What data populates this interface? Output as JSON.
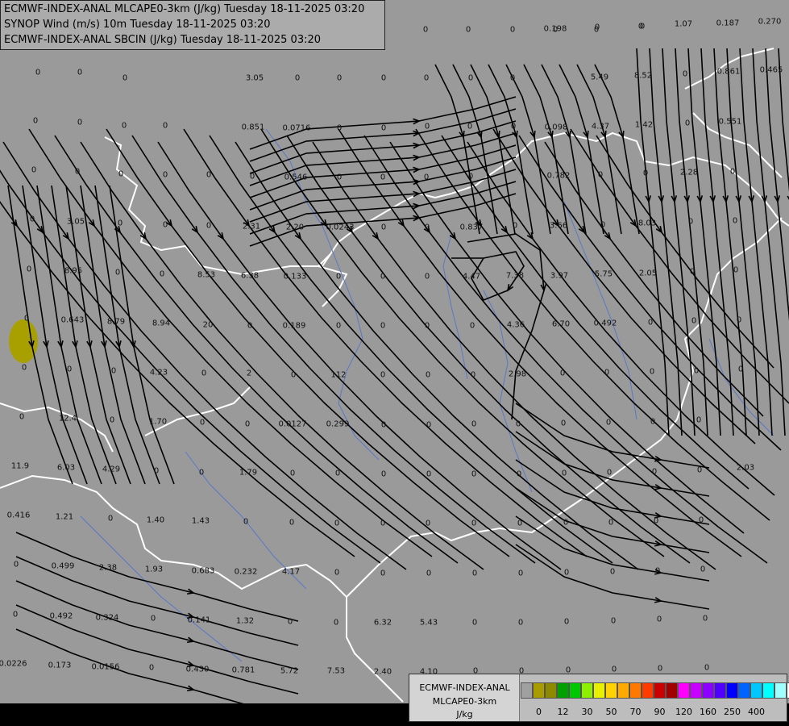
{
  "header": {
    "line1": "ECMWF-INDEX-ANAL MLCAPE0-3km (J/kg) Tuesday 18-11-2025 03:20",
    "line2": "SYNOP Wind (m/s) 10m Tuesday 18-11-2025 03:20",
    "line3": "ECMWF-INDEX-ANAL SBCIN (J/kg) Tuesday 18-11-2025 03:20"
  },
  "legend": {
    "title1": "ECMWF-INDEX-ANAL",
    "title2": "MLCAPE0-3km",
    "unit": "J/kg",
    "colors": [
      "#a0a0a0",
      "#a89c00",
      "#8e8a00",
      "#00a000",
      "#00c800",
      "#8cf000",
      "#e6f000",
      "#ffd200",
      "#ffaa00",
      "#ff7800",
      "#ff3c00",
      "#c80000",
      "#a00000",
      "#ff00ff",
      "#c800ff",
      "#8c00ff",
      "#5000ff",
      "#0000ff",
      "#0064ff",
      "#00c8ff",
      "#00ffff",
      "#a0ffff",
      "#ffffff"
    ],
    "tick_labels": [
      "0",
      "12",
      "30",
      "50",
      "70",
      "90",
      "120",
      "160",
      "250",
      "400"
    ]
  },
  "cape_values": [
    {
      "t": "0"
    },
    {
      "t": "0"
    },
    {
      "t": "0"
    },
    {
      "t": "0"
    },
    {
      "t": "0"
    },
    {
      "t": "0"
    },
    {
      "t": "1.07"
    },
    {
      "t": "0.198"
    },
    {
      "t": "0"
    },
    {
      "t": "0"
    },
    {
      "t": "0.187"
    },
    {
      "t": "0.270"
    },
    {
      "t": "0"
    },
    {
      "t": "0"
    },
    {
      "t": "0"
    },
    {
      "t": "3.05"
    },
    {
      "t": "0"
    },
    {
      "t": "0"
    },
    {
      "t": "0"
    },
    {
      "t": "0"
    },
    {
      "t": "0"
    },
    {
      "t": "0"
    },
    {
      "t": "5.49"
    },
    {
      "t": "8.52"
    },
    {
      "t": "0"
    },
    {
      "t": "0.861"
    },
    {
      "t": "0.465"
    },
    {
      "t": "0"
    },
    {
      "t": "0"
    },
    {
      "t": "0"
    },
    {
      "t": "0"
    },
    {
      "t": "0.851"
    },
    {
      "t": "0.0716"
    },
    {
      "t": "0"
    },
    {
      "t": "0"
    },
    {
      "t": "0"
    },
    {
      "t": "0"
    },
    {
      "t": "0"
    },
    {
      "t": "0.098"
    },
    {
      "t": "4.37"
    },
    {
      "t": "1.42"
    },
    {
      "t": "0"
    },
    {
      "t": "0.551"
    },
    {
      "t": "0"
    },
    {
      "t": "0"
    },
    {
      "t": "0"
    },
    {
      "t": "0"
    },
    {
      "t": "0"
    },
    {
      "t": "0"
    },
    {
      "t": "0.546"
    },
    {
      "t": "0"
    },
    {
      "t": "0"
    },
    {
      "t": "0"
    },
    {
      "t": "0"
    },
    {
      "t": "0.782"
    },
    {
      "t": "0"
    },
    {
      "t": "0"
    },
    {
      "t": "2.28"
    },
    {
      "t": "0"
    },
    {
      "t": "0"
    },
    {
      "t": "3.05"
    },
    {
      "t": "0"
    },
    {
      "t": "0"
    },
    {
      "t": "0"
    },
    {
      "t": "2.31"
    },
    {
      "t": "2.20"
    },
    {
      "t": "0.0243"
    },
    {
      "t": "0"
    },
    {
      "t": "0"
    },
    {
      "t": "0.837"
    },
    {
      "t": "0"
    },
    {
      "t": "3.66"
    },
    {
      "t": "0"
    },
    {
      "t": "8.03"
    },
    {
      "t": "0"
    },
    {
      "t": "0"
    },
    {
      "t": "0"
    },
    {
      "t": "8.95"
    },
    {
      "t": "0"
    },
    {
      "t": "0"
    },
    {
      "t": "8.53"
    },
    {
      "t": "6.38"
    },
    {
      "t": "0.133"
    },
    {
      "t": "0"
    },
    {
      "t": "0"
    },
    {
      "t": "0"
    },
    {
      "t": "4.47"
    },
    {
      "t": "7.38"
    },
    {
      "t": "3.97"
    },
    {
      "t": "5.75"
    },
    {
      "t": "2.05"
    },
    {
      "t": "0"
    },
    {
      "t": "0"
    },
    {
      "t": "0"
    },
    {
      "t": "0.643"
    },
    {
      "t": "8.79"
    },
    {
      "t": "8.94"
    },
    {
      "t": "20"
    },
    {
      "t": "0"
    },
    {
      "t": "0.189"
    },
    {
      "t": "0"
    },
    {
      "t": "0"
    },
    {
      "t": "0"
    },
    {
      "t": "0"
    },
    {
      "t": "4.36"
    },
    {
      "t": "6.70"
    },
    {
      "t": "0.492"
    },
    {
      "t": "0"
    },
    {
      "t": "0"
    },
    {
      "t": "0"
    },
    {
      "t": "0"
    },
    {
      "t": "0"
    },
    {
      "t": "0"
    },
    {
      "t": "4.23"
    },
    {
      "t": "0"
    },
    {
      "t": "2"
    },
    {
      "t": "0"
    },
    {
      "t": "112"
    },
    {
      "t": "0"
    },
    {
      "t": "0"
    },
    {
      "t": "0"
    },
    {
      "t": "2.98"
    },
    {
      "t": "0"
    },
    {
      "t": "0"
    },
    {
      "t": "0"
    },
    {
      "t": "0"
    },
    {
      "t": "0"
    },
    {
      "t": "0"
    },
    {
      "t": "12.4"
    },
    {
      "t": "0"
    },
    {
      "t": "1.70"
    },
    {
      "t": "0"
    },
    {
      "t": "0"
    },
    {
      "t": "0.0127"
    },
    {
      "t": "0.299"
    },
    {
      "t": "0"
    },
    {
      "t": "0"
    },
    {
      "t": "0"
    },
    {
      "t": "0"
    },
    {
      "t": "0"
    },
    {
      "t": "0"
    },
    {
      "t": "0"
    },
    {
      "t": "0"
    },
    {
      "t": "11.9"
    },
    {
      "t": "6.03"
    },
    {
      "t": "4.29"
    },
    {
      "t": "0"
    },
    {
      "t": "0"
    },
    {
      "t": "1.79"
    },
    {
      "t": "0"
    },
    {
      "t": "0"
    },
    {
      "t": "0"
    },
    {
      "t": "0"
    },
    {
      "t": "0"
    },
    {
      "t": "0"
    },
    {
      "t": "0"
    },
    {
      "t": "0"
    },
    {
      "t": "0"
    },
    {
      "t": "0"
    },
    {
      "t": "2.03"
    },
    {
      "t": "0.416"
    },
    {
      "t": "1.21"
    },
    {
      "t": "0"
    },
    {
      "t": "1.40"
    },
    {
      "t": "1.43"
    },
    {
      "t": "0"
    },
    {
      "t": "0"
    },
    {
      "t": "0"
    },
    {
      "t": "0"
    },
    {
      "t": "0"
    },
    {
      "t": "0"
    },
    {
      "t": "0"
    },
    {
      "t": "0"
    },
    {
      "t": "0"
    },
    {
      "t": "0"
    },
    {
      "t": "0"
    },
    {
      "t": "0"
    },
    {
      "t": "0.499"
    },
    {
      "t": "2.38"
    },
    {
      "t": "1.93"
    },
    {
      "t": "0.683"
    },
    {
      "t": "0.232"
    },
    {
      "t": "4.17"
    },
    {
      "t": "0"
    },
    {
      "t": "0"
    },
    {
      "t": "0"
    },
    {
      "t": "0"
    },
    {
      "t": "0"
    },
    {
      "t": "0"
    },
    {
      "t": "0"
    },
    {
      "t": "0"
    },
    {
      "t": "0"
    },
    {
      "t": "0"
    },
    {
      "t": "0.492"
    },
    {
      "t": "0.324"
    },
    {
      "t": "0"
    },
    {
      "t": "0.141"
    },
    {
      "t": "1.32"
    },
    {
      "t": "0"
    },
    {
      "t": "0"
    },
    {
      "t": "6.32"
    },
    {
      "t": "5.43"
    },
    {
      "t": "0"
    },
    {
      "t": "0"
    },
    {
      "t": "0"
    },
    {
      "t": "0"
    },
    {
      "t": "0"
    },
    {
      "t": "0"
    },
    {
      "t": "0.0226"
    },
    {
      "t": "0.173"
    },
    {
      "t": "0.0156"
    },
    {
      "t": "0"
    },
    {
      "t": "0.430"
    },
    {
      "t": "0.781"
    },
    {
      "t": "5.72"
    },
    {
      "t": "7.53"
    },
    {
      "t": "2.40"
    },
    {
      "t": "4.10"
    },
    {
      "t": "0"
    },
    {
      "t": "0"
    },
    {
      "t": "0"
    },
    {
      "t": "0"
    },
    {
      "t": "0"
    },
    {
      "t": "0"
    }
  ]
}
